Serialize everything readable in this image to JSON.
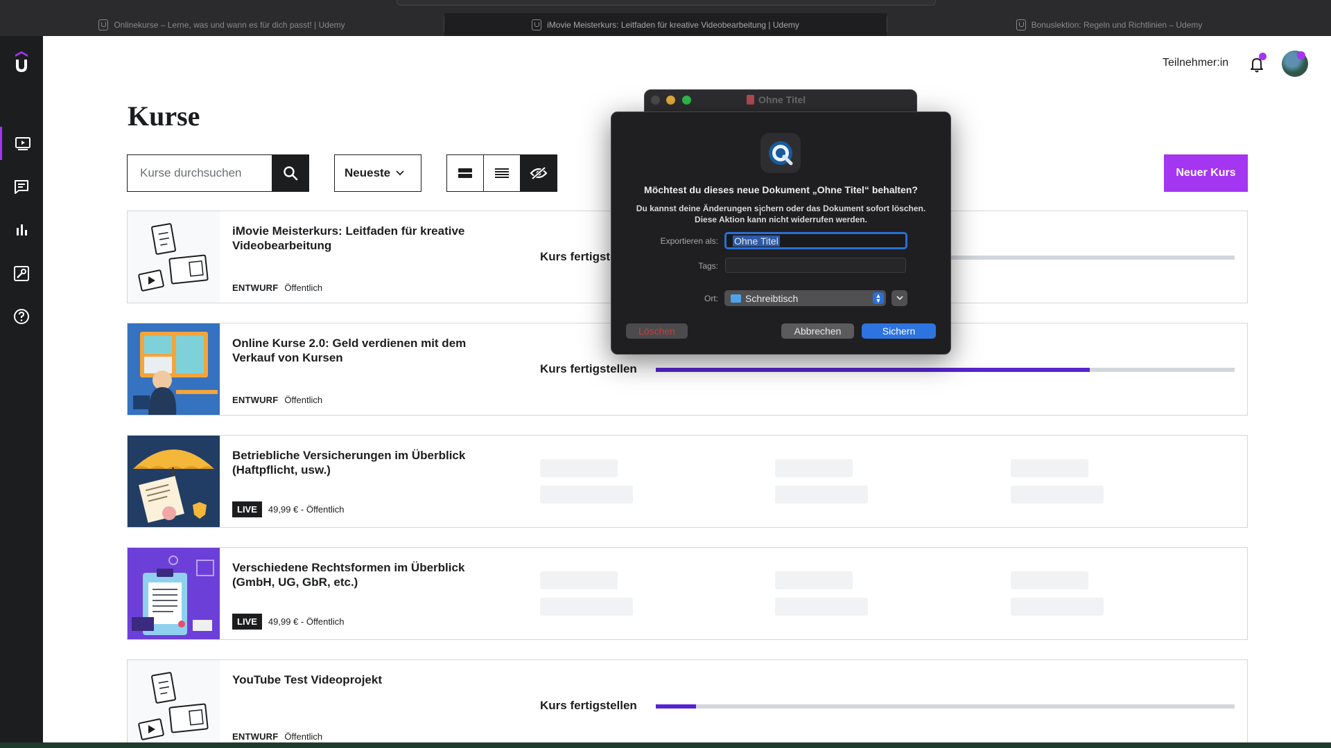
{
  "browser": {
    "tabs": [
      {
        "title": "Onlinekurse – Lerne, was und wann es für dich passt! | Udemy",
        "active": false
      },
      {
        "title": "iMovie Meisterkurs: Leitfaden für kreative Videobearbeitung | Udemy",
        "active": true
      },
      {
        "title": "Bonuslektion: Regeln und Richtlinien – Udemy",
        "active": false
      }
    ]
  },
  "header": {
    "role_link": "Teilnehmer:in",
    "notification_icon": "bell-icon",
    "accent_color": "#a435f0"
  },
  "sidebar": {
    "items": [
      {
        "name": "courses",
        "icon": "video-icon",
        "active": true
      },
      {
        "name": "communication",
        "icon": "chat-icon",
        "active": false
      },
      {
        "name": "performance",
        "icon": "bar-chart-icon",
        "active": false
      },
      {
        "name": "tools",
        "icon": "tools-icon",
        "active": false
      },
      {
        "name": "resources",
        "icon": "help-icon",
        "active": false
      }
    ]
  },
  "main": {
    "title": "Kurse",
    "search_placeholder": "Kurse durchsuchen",
    "sort_label": "Neueste",
    "new_course_label": "Neuer Kurs",
    "complete_label": "Kurs fertigstellen",
    "courses": [
      {
        "title": "iMovie Meisterkurs: Leitfaden für kreative Videobearbeitung",
        "status": "ENTWURF",
        "meta": "Öffentlich",
        "progress": 0.5
      },
      {
        "title": "Online Kurse 2.0: Geld verdienen mit dem Verkauf von Kursen",
        "status": "ENTWURF",
        "meta": "Öffentlich",
        "progress": 0.75
      },
      {
        "title": "Betriebliche Versicherungen im Überblick (Haftpflicht, usw.)",
        "status": "LIVE",
        "meta": "49,99 € - Öffentlich"
      },
      {
        "title": "Verschiedene Rechtsformen im Überblick (GmbH, UG, GbR, etc.)",
        "status": "LIVE",
        "meta": "49,99 € - Öffentlich"
      },
      {
        "title": "YouTube Test Videoprojekt",
        "status": "ENTWURF",
        "meta": "Öffentlich",
        "progress": 0.07
      }
    ]
  },
  "dialog": {
    "window_title": "Ohne Titel",
    "title": "Möchtest du dieses neue Dokument „Ohne Titel“ behalten?",
    "message_line1": "Du kannst deine Änderungen sichern oder das Dokument sofort löschen.",
    "message_line2": "Diese Aktion kann nicht widerrufen werden.",
    "export_label": "Exportieren als:",
    "export_value": "Ohne Titel",
    "tags_label": "Tags:",
    "location_label": "Ort:",
    "location_value": "Schreibtisch",
    "delete_label": "Löschen",
    "cancel_label": "Abbrechen",
    "save_label": "Sichern"
  }
}
